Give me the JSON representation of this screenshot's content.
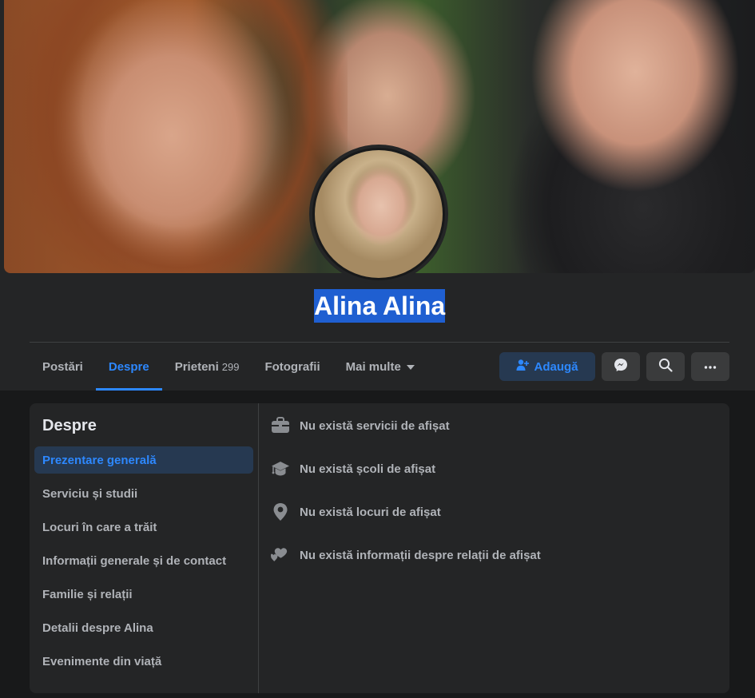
{
  "profile": {
    "name": "Alina Alina"
  },
  "tabs": [
    {
      "label": "Postări"
    },
    {
      "label": "Despre",
      "active": true
    },
    {
      "label": "Prieteni",
      "count": "299"
    },
    {
      "label": "Fotografii"
    },
    {
      "label": "Mai multe"
    }
  ],
  "actions": {
    "add_label": "Adaugă",
    "messenger_icon": "messenger-icon",
    "search_icon": "search-icon",
    "more_icon": "more-icon"
  },
  "about": {
    "title": "Despre",
    "sidebar": [
      {
        "label": "Prezentare generală",
        "active": true
      },
      {
        "label": "Serviciu și studii"
      },
      {
        "label": "Locuri în care a trăit"
      },
      {
        "label": "Informații generale și de contact"
      },
      {
        "label": "Familie și relații"
      },
      {
        "label": "Detalii despre Alina"
      },
      {
        "label": "Evenimente din viață"
      }
    ],
    "items": [
      {
        "icon": "briefcase-icon",
        "text": "Nu există servicii de afișat"
      },
      {
        "icon": "graduation-cap-icon",
        "text": "Nu există școli de afișat"
      },
      {
        "icon": "location-pin-icon",
        "text": "Nu există locuri de afișat"
      },
      {
        "icon": "hearts-icon",
        "text": "Nu există informații despre relații de afișat"
      }
    ]
  },
  "colors": {
    "accent": "#2d88ff",
    "background": "#18191a",
    "surface": "#242526",
    "selection": "#1f5fd1"
  }
}
